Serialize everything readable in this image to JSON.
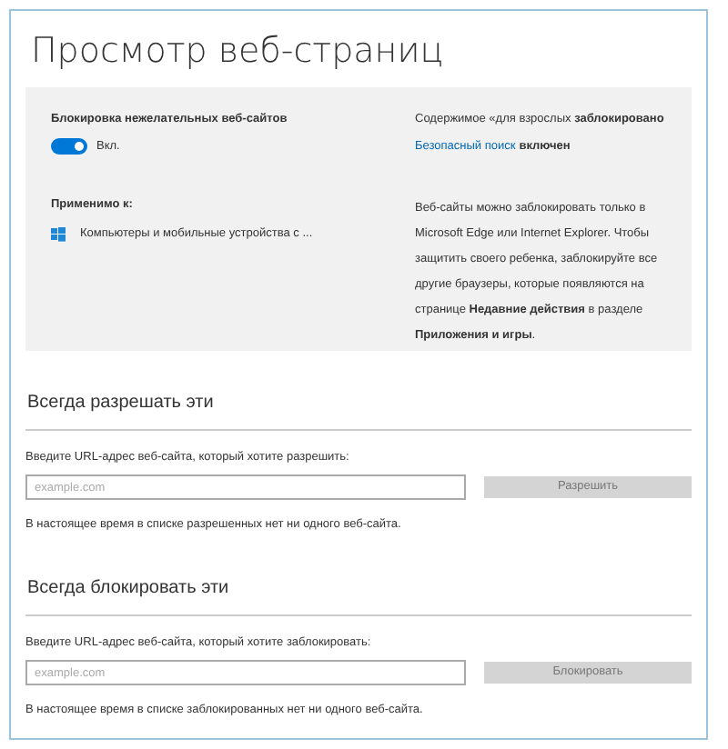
{
  "title": "Просмотр веб-страниц",
  "panel": {
    "block_label": "Блокировка нежелательных веб-сайтов",
    "toggle": {
      "on": true,
      "label": "Вкл."
    },
    "adult_status": "Содержимое «для взрослых **заблокировано**",
    "safe_search": {
      "link": "Безопасный поиск",
      "status": "включен"
    },
    "applies_label": "Применимо к:",
    "applies_value": "Компьютеры и мобильные устройства с ...",
    "note": "Веб-сайты можно заблокировать только в Microsoft Edge или Internet Explorer. Чтобы защитить своего ребенка, заблокируйте все другие браузеры, которые появляются на странице **Недавние действия** в разделе **Приложения и игры**."
  },
  "sections": [
    {
      "heading": "Всегда разрешать эти",
      "prompt": "Введите URL-адрес веб-сайта, который хотите разрешить:",
      "placeholder": "example.com",
      "button": {
        "label": "Разрешить",
        "disabled": true
      },
      "empty_message": "В настоящее время в списке разрешенных нет ни одного веб-сайта."
    },
    {
      "heading": "Всегда блокировать эти",
      "prompt": "Введите URL-адрес веб-сайта, который хотите заблокировать:",
      "placeholder": "example.com",
      "button": {
        "label": "Блокировать",
        "disabled": true
      },
      "empty_message": "В настоящее время в списке заблокированных нет ни одного веб-сайта."
    }
  ]
}
